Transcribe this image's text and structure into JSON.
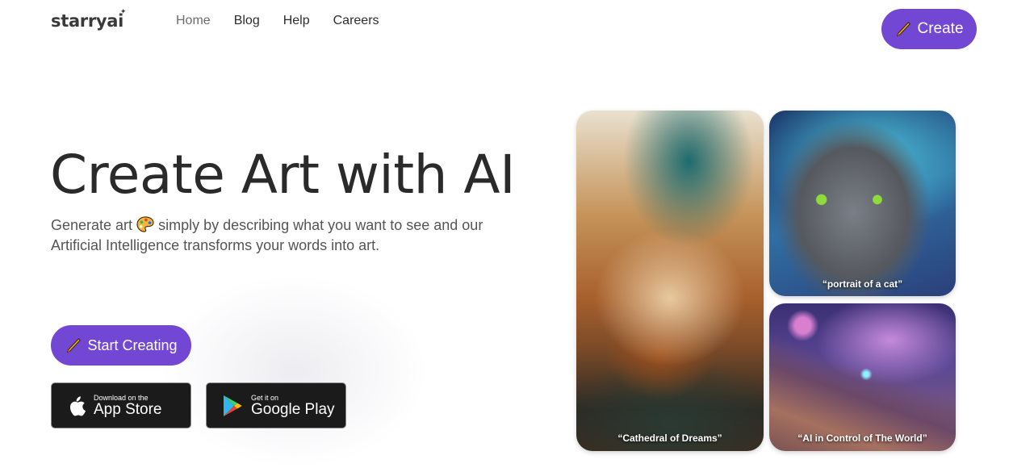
{
  "brand": {
    "logo_text": "starryai",
    "logo_spark": "✦",
    "accent": "#7247d4"
  },
  "nav": {
    "items": [
      {
        "label": "Home",
        "active": true
      },
      {
        "label": "Blog",
        "active": false
      },
      {
        "label": "Help",
        "active": false
      },
      {
        "label": "Careers",
        "active": false
      }
    ]
  },
  "header": {
    "create_label": "Create",
    "create_icon": "pencil-icon"
  },
  "hero": {
    "title": "Create Art with AI",
    "subtitle_part1": "Generate art",
    "subtitle_icon": "artist-palette-icon",
    "subtitle_part2": "simply by describing what you want to see and our Artificial Intelligence transforms your words into art.",
    "start_label": "Start Creating"
  },
  "stores": {
    "app_store": {
      "small": "Download on the",
      "big": "App Store",
      "icon": "apple-icon"
    },
    "google_play": {
      "small": "Get it on",
      "big": "Google Play",
      "icon": "google-play-icon"
    }
  },
  "gallery": [
    {
      "caption": "“Cathedral of Dreams”"
    },
    {
      "caption": "“portrait of a cat”"
    },
    {
      "caption": "“AI in Control of The World”"
    }
  ]
}
